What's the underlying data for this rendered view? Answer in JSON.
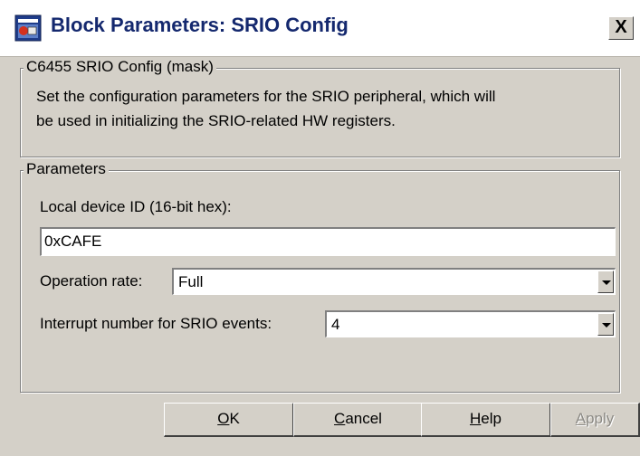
{
  "window": {
    "title": "Block Parameters: SRIO Config",
    "close_label": "X"
  },
  "mask_group": {
    "legend": "C6455 SRIO Config (mask)",
    "description_line1": "Set the configuration parameters for the SRIO peripheral, which will",
    "description_line2": "be used in initializing the SRIO-related HW registers."
  },
  "params_group": {
    "legend": "Parameters",
    "device_id_label": "Local device ID (16-bit hex):",
    "device_id_value": "0xCAFE",
    "operation_rate_label": "Operation rate:",
    "operation_rate_value": "Full",
    "interrupt_label": "Interrupt number for SRIO events:",
    "interrupt_value": "4"
  },
  "buttons": {
    "ok": "OK",
    "cancel": "Cancel",
    "help": "Help",
    "apply": "Apply",
    "apply_enabled": false
  },
  "icons": {
    "app_icon": "simulink-block-icon",
    "combo_arrow": "chevron-down-icon"
  },
  "colors": {
    "title_text": "#14286e",
    "dialog_bg": "#d4d0c8",
    "titlebar_bg": "#ffffff"
  }
}
